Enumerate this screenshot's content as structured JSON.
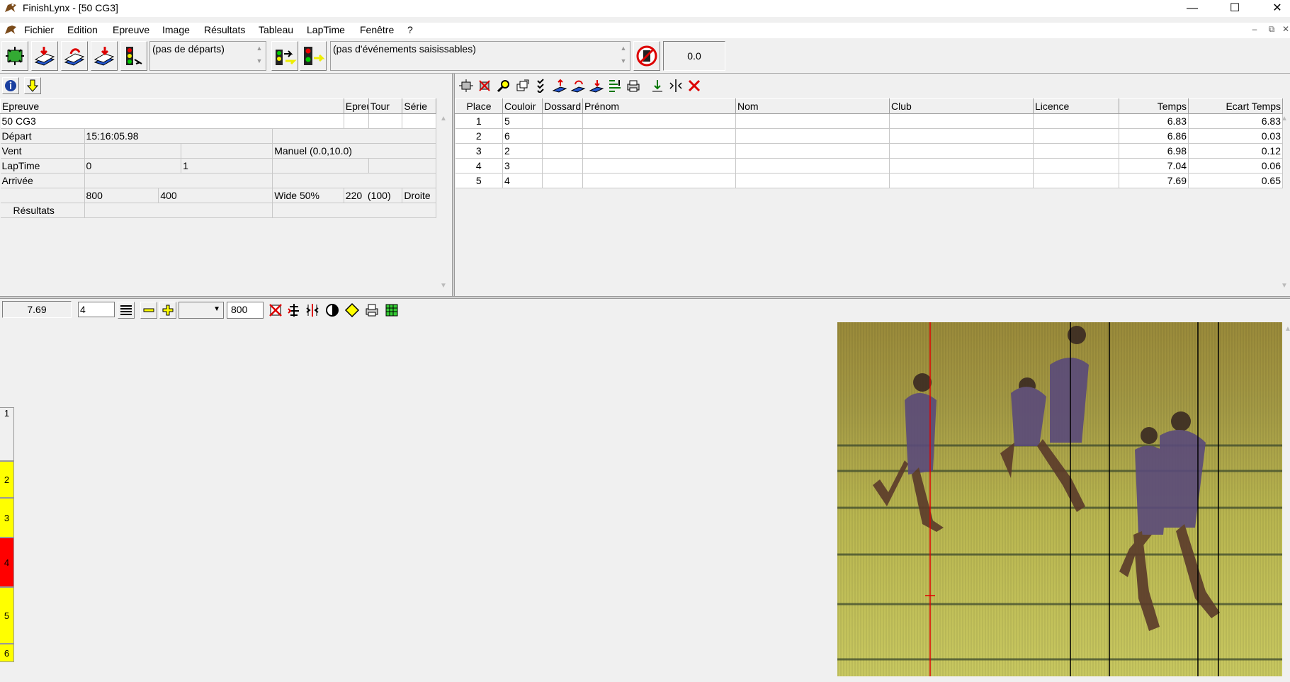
{
  "app": {
    "title": "FinishLynx - [50 CG3]"
  },
  "menu": [
    "Fichier",
    "Edition",
    "Epreuve",
    "Image",
    "Résultats",
    "Tableau",
    "LapTime",
    "Fenêtre",
    "?"
  ],
  "toolbar": {
    "starts_combo": "(pas de départs)",
    "events_combo": "(pas d'événements saisissables)",
    "wind_value": "0.0"
  },
  "event_panel": {
    "headers": {
      "epreuve": "Epreuve",
      "epreuve_n": "Epreuve n",
      "tour": "Tour",
      "serie": "Série"
    },
    "event_name": "50 CG3",
    "depart_label": "Départ",
    "depart_value": "15:16:05.98",
    "vent_label": "Vent",
    "vent_value": "Manuel (0.0,10.0)",
    "laptime_label": "LapTime",
    "laptime_a": "0",
    "laptime_b": "1",
    "arrivee_label": "Arrivée",
    "cam_a": "800",
    "cam_b": "400",
    "cam_c": "Wide 50%",
    "cam_d": "220",
    "cam_e": "(100)",
    "cam_f": "Droite",
    "resultats_label": "Résultats"
  },
  "results": {
    "columns": [
      "Place",
      "Couloir",
      "Dossard",
      "Prénom",
      "Nom",
      "Club",
      "Licence",
      "Temps",
      "Ecart Temps"
    ],
    "rows": [
      {
        "place": "1",
        "couloir": "5",
        "temps": "6.83",
        "ecart": "6.83"
      },
      {
        "place": "2",
        "couloir": "6",
        "temps": "6.86",
        "ecart": "0.03"
      },
      {
        "place": "3",
        "couloir": "2",
        "temps": "6.98",
        "ecart": "0.12"
      },
      {
        "place": "4",
        "couloir": "3",
        "temps": "7.04",
        "ecart": "0.06"
      },
      {
        "place": "5",
        "couloir": "4",
        "temps": "7.69",
        "ecart": "0.65"
      }
    ]
  },
  "image_toolbar": {
    "time": "7.69",
    "lane_input": "4",
    "density": "800"
  },
  "lanes": [
    {
      "label": "1",
      "color": "#f0f0f0"
    },
    {
      "label": "2",
      "color": "#ffff00"
    },
    {
      "label": "3",
      "color": "#ffff00"
    },
    {
      "label": "4",
      "color": "#ff0000"
    },
    {
      "label": "5",
      "color": "#ffff00"
    },
    {
      "label": "6",
      "color": "#ffff00"
    }
  ],
  "colors": {
    "yellow": "#ffff00",
    "red": "#ff0000"
  }
}
